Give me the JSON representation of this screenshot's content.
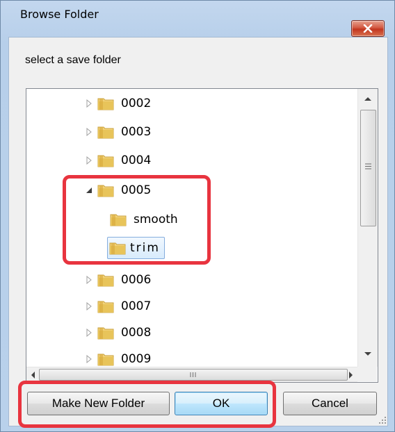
{
  "dialog": {
    "title": "Browse Folder",
    "close_icon": "close-x-icon",
    "prompt": "select a save folder"
  },
  "tree": {
    "items": [
      {
        "label": "0002",
        "expander": "collapsed",
        "level": 0
      },
      {
        "label": "0003",
        "expander": "collapsed",
        "level": 0
      },
      {
        "label": "0004",
        "expander": "collapsed",
        "level": 0
      },
      {
        "label": "0005",
        "expander": "expanded",
        "level": 0
      },
      {
        "label": "smooth",
        "expander": "none",
        "level": 1
      },
      {
        "label": "trim",
        "expander": "none",
        "level": 1,
        "selected": true
      },
      {
        "label": "0006",
        "expander": "collapsed",
        "level": 0
      },
      {
        "label": "0007",
        "expander": "collapsed",
        "level": 0
      },
      {
        "label": "0008",
        "expander": "collapsed",
        "level": 0
      },
      {
        "label": "0009",
        "expander": "collapsed",
        "level": 0
      }
    ]
  },
  "buttons": {
    "make_new_folder": "Make New Folder",
    "ok": "OK",
    "cancel": "Cancel"
  },
  "colors": {
    "highlight": "#e8343f",
    "folder": "#e8c45a",
    "selection": "#d8ebfc"
  }
}
